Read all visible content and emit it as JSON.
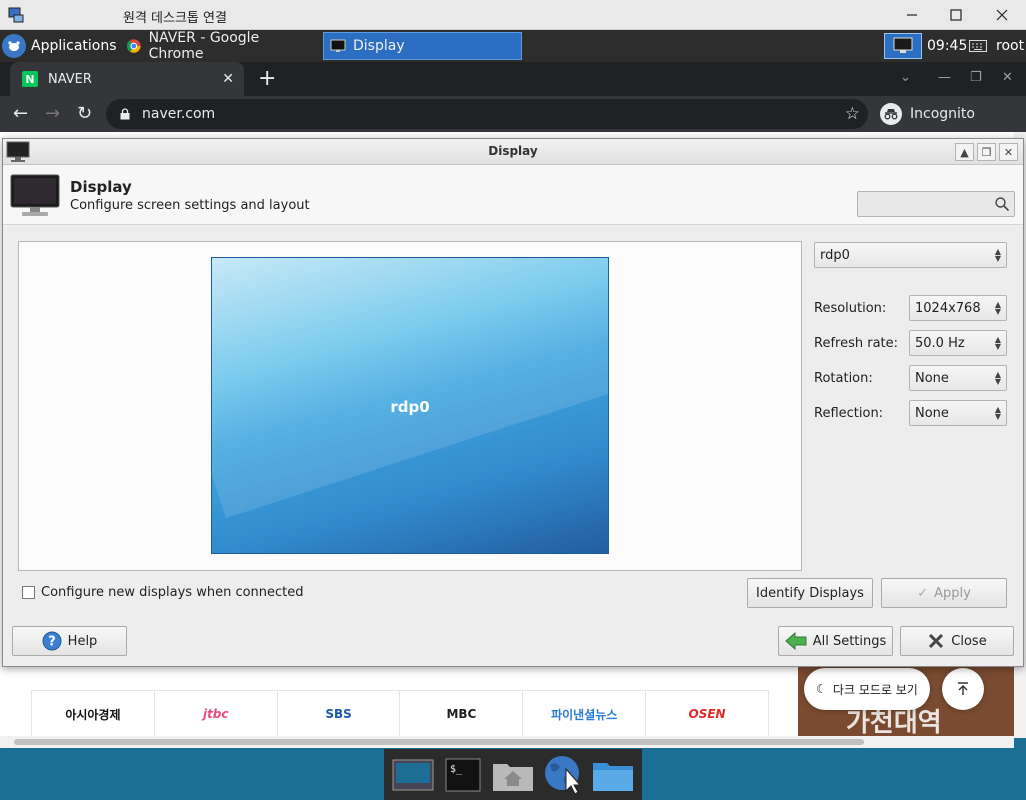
{
  "rdp": {
    "title": "원격 데스크톱 연결"
  },
  "panel": {
    "apps_label": "Applications",
    "tasks": [
      {
        "label": "NAVER - Google Chrome",
        "active": false
      },
      {
        "label": "Display",
        "active": true
      }
    ],
    "clock": "09:45",
    "user": "root"
  },
  "chrome": {
    "tab_title": "NAVER",
    "url": "naver.com",
    "incognito_label": "Incognito"
  },
  "web": {
    "logos": [
      "아시아경제",
      "jtbc",
      "SBS",
      "MBC",
      "파이낸셜뉴스",
      "OSEN"
    ],
    "dark_mode_label": "다크 모드로 보기",
    "banner_text": "가천대역"
  },
  "dialog": {
    "window_title": "Display",
    "header_title": "Display",
    "header_subtitle": "Configure screen settings and layout",
    "screen_label": "rdp0",
    "output_select": "rdp0",
    "resolution_label": "Resolution:",
    "resolution_value": "1024x768",
    "refresh_label": "Refresh rate:",
    "refresh_value": "50.0 Hz",
    "rotation_label": "Rotation:",
    "rotation_value": "None",
    "reflection_label": "Reflection:",
    "reflection_value": "None",
    "configure_new_label": "Configure new displays when connected",
    "configure_new_checked": false,
    "identify_label": "Identify Displays",
    "apply_label": "Apply",
    "help_label": "Help",
    "all_settings_label": "All Settings",
    "close_label": "Close"
  }
}
